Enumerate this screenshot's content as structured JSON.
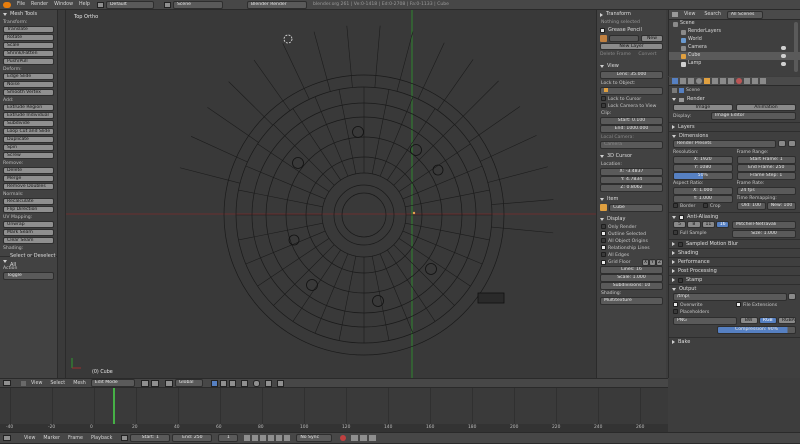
{
  "topbar": {
    "menus": [
      "File",
      "Render",
      "Window",
      "Help"
    ],
    "layout": "Default",
    "scene": "Scene",
    "engine": "Blender Render",
    "info": "blender.org 261 | Ve:0-1418 | Ed:0-2708 | Fa:0-1133 | Cube"
  },
  "tools": {
    "title": "Mesh Tools",
    "groups": [
      {
        "title": "Transform:",
        "buttons": [
          "Translate",
          "Rotate",
          "Scale",
          "Shrink/Fatten",
          "Push/Pull"
        ]
      },
      {
        "title": "Deform:",
        "buttons": [
          "Edge Slide",
          "Noise",
          "Smooth Vertex"
        ]
      },
      {
        "title": "Add:",
        "buttons": [
          "Extrude Region",
          "Extrude Individual",
          "Subdivide",
          "Loop Cut and Slide",
          "Duplicate",
          "Spin",
          "Screw"
        ]
      },
      {
        "title": "Remove:",
        "buttons": [
          "Delete",
          "Merge",
          "Remove Doubles"
        ]
      },
      {
        "title": "Normals:",
        "buttons": [
          "Recalculate",
          "Flip Direction"
        ]
      },
      {
        "title": "UV Mapping:",
        "buttons": [
          "Unwrap",
          "Mark Seam",
          "Clear Seam"
        ]
      },
      {
        "title": "Shading:",
        "buttons": []
      }
    ],
    "op_title": "Select or Deselect All",
    "action_label": "Action",
    "action_value": "Toggle"
  },
  "viewport": {
    "title": "Top Ortho",
    "object": "(0) Cube"
  },
  "props_n": {
    "transform_title": "Transform",
    "nothing_selected": "Nothing selected",
    "grease_title": "Grease Pencil",
    "new_label": "New",
    "new_layer": "New Layer",
    "delete_frame": "Delete Frame",
    "convert": "Convert",
    "view_title": "View",
    "lens": "Lens: 35.000",
    "lock_object": "Lock to Object:",
    "lock_cursor": "Lock to Cursor",
    "lock_camera": "Lock Camera to View",
    "clip": "Clip:",
    "clip_start": "Start: 0.100",
    "clip_end": "End: 1000.000",
    "local_camera": "Local Camera:",
    "camera": "Camera",
    "cursor_title": "3D Cursor",
    "location": "Location:",
    "cx": "X: -3.4837",
    "cy": "Y: 4.7834",
    "cz": "Z: 0.8062",
    "item_title": "Item",
    "item_name": "Cube",
    "display_title": "Display",
    "only_render": "Only Render",
    "outline_selected": "Outline Selected",
    "all_origins": "All Object Origins",
    "relationship": "Relationship Lines",
    "all_edges": "All Edges",
    "grid_floor": "Grid Floor",
    "axis_x": "X",
    "axis_y": "Y",
    "axis_z": "Z",
    "lines": "Lines: 16",
    "scale": "Scale: 1.000",
    "subdivisions": "Subdivisions: 10",
    "shading_label": "Shading:",
    "shading_value": "Multitexture"
  },
  "outliner": {
    "view": "View",
    "search": "Search",
    "filter": "All Scenes",
    "items": [
      "Scene",
      "RenderLayers",
      "World",
      "Camera",
      "Cube",
      "Lamp"
    ]
  },
  "render_props": {
    "scene_name": "Scene",
    "render_title": "Render",
    "image_btn": "Image",
    "animation_btn": "Animation",
    "display_label": "Display:",
    "display_value": "Image Editor",
    "layers": "Layers",
    "dimensions": "Dimensions",
    "presets": "Render Presets",
    "resolution": "Resolution:",
    "res_x": "X: 1920",
    "res_y": "Y: 1080",
    "res_pct": "50%",
    "frame_range": "Frame Range:",
    "start_frame": "Start Frame: 1",
    "end_frame": "End Frame: 250",
    "frame_step": "Frame Step: 1",
    "aspect": "Aspect Ratio:",
    "asp_x": "X: 1.000",
    "asp_y": "Y: 1.000",
    "frame_rate": "Frame Rate:",
    "fps": "24 fps",
    "time_remap": "Time Remapping:",
    "old": "Old: 100",
    "new": "New: 100",
    "border": "Border",
    "crop": "Crop",
    "aa_title": "Anti-Aliasing",
    "aa_samples": [
      "5",
      "8",
      "11",
      "16"
    ],
    "aa_filter": "Mitchell-Netravali",
    "full_sample": "Full Sample",
    "size": "Size: 1.000",
    "motion_blur": "Sampled Motion Blur",
    "shading": "Shading",
    "performance": "Performance",
    "post": "Post Processing",
    "stamp": "Stamp",
    "output": "Output",
    "output_path": "/tmp\\",
    "overwrite": "Overwrite",
    "file_ext": "File Extensions",
    "placeholders": "Placeholders",
    "format": "PNG",
    "bw": "BW",
    "rgb": "RGB",
    "rgba": "RGBA",
    "compression": "Compression: 90%",
    "bake": "Bake"
  },
  "header3d": {
    "menus": [
      "View",
      "Select",
      "Mesh"
    ],
    "mode": "Edit Mode",
    "orientation": "Global"
  },
  "timeline": {
    "ticks": [
      "-40",
      "-20",
      "0",
      "20",
      "40",
      "60",
      "80",
      "100",
      "120",
      "140",
      "160",
      "180",
      "200",
      "220",
      "240",
      "260"
    ],
    "menus": [
      "View",
      "Marker",
      "Frame",
      "Playback"
    ],
    "start": "Start: 1",
    "end": "End: 250",
    "current": "1",
    "sync": "No Sync"
  },
  "colors": {
    "accent_blue": "#5680c2",
    "x_axis": "#8b2a2a",
    "y_axis": "#2f8b2f",
    "cursor": "#e8e8e8",
    "current_frame": "#46b046"
  }
}
